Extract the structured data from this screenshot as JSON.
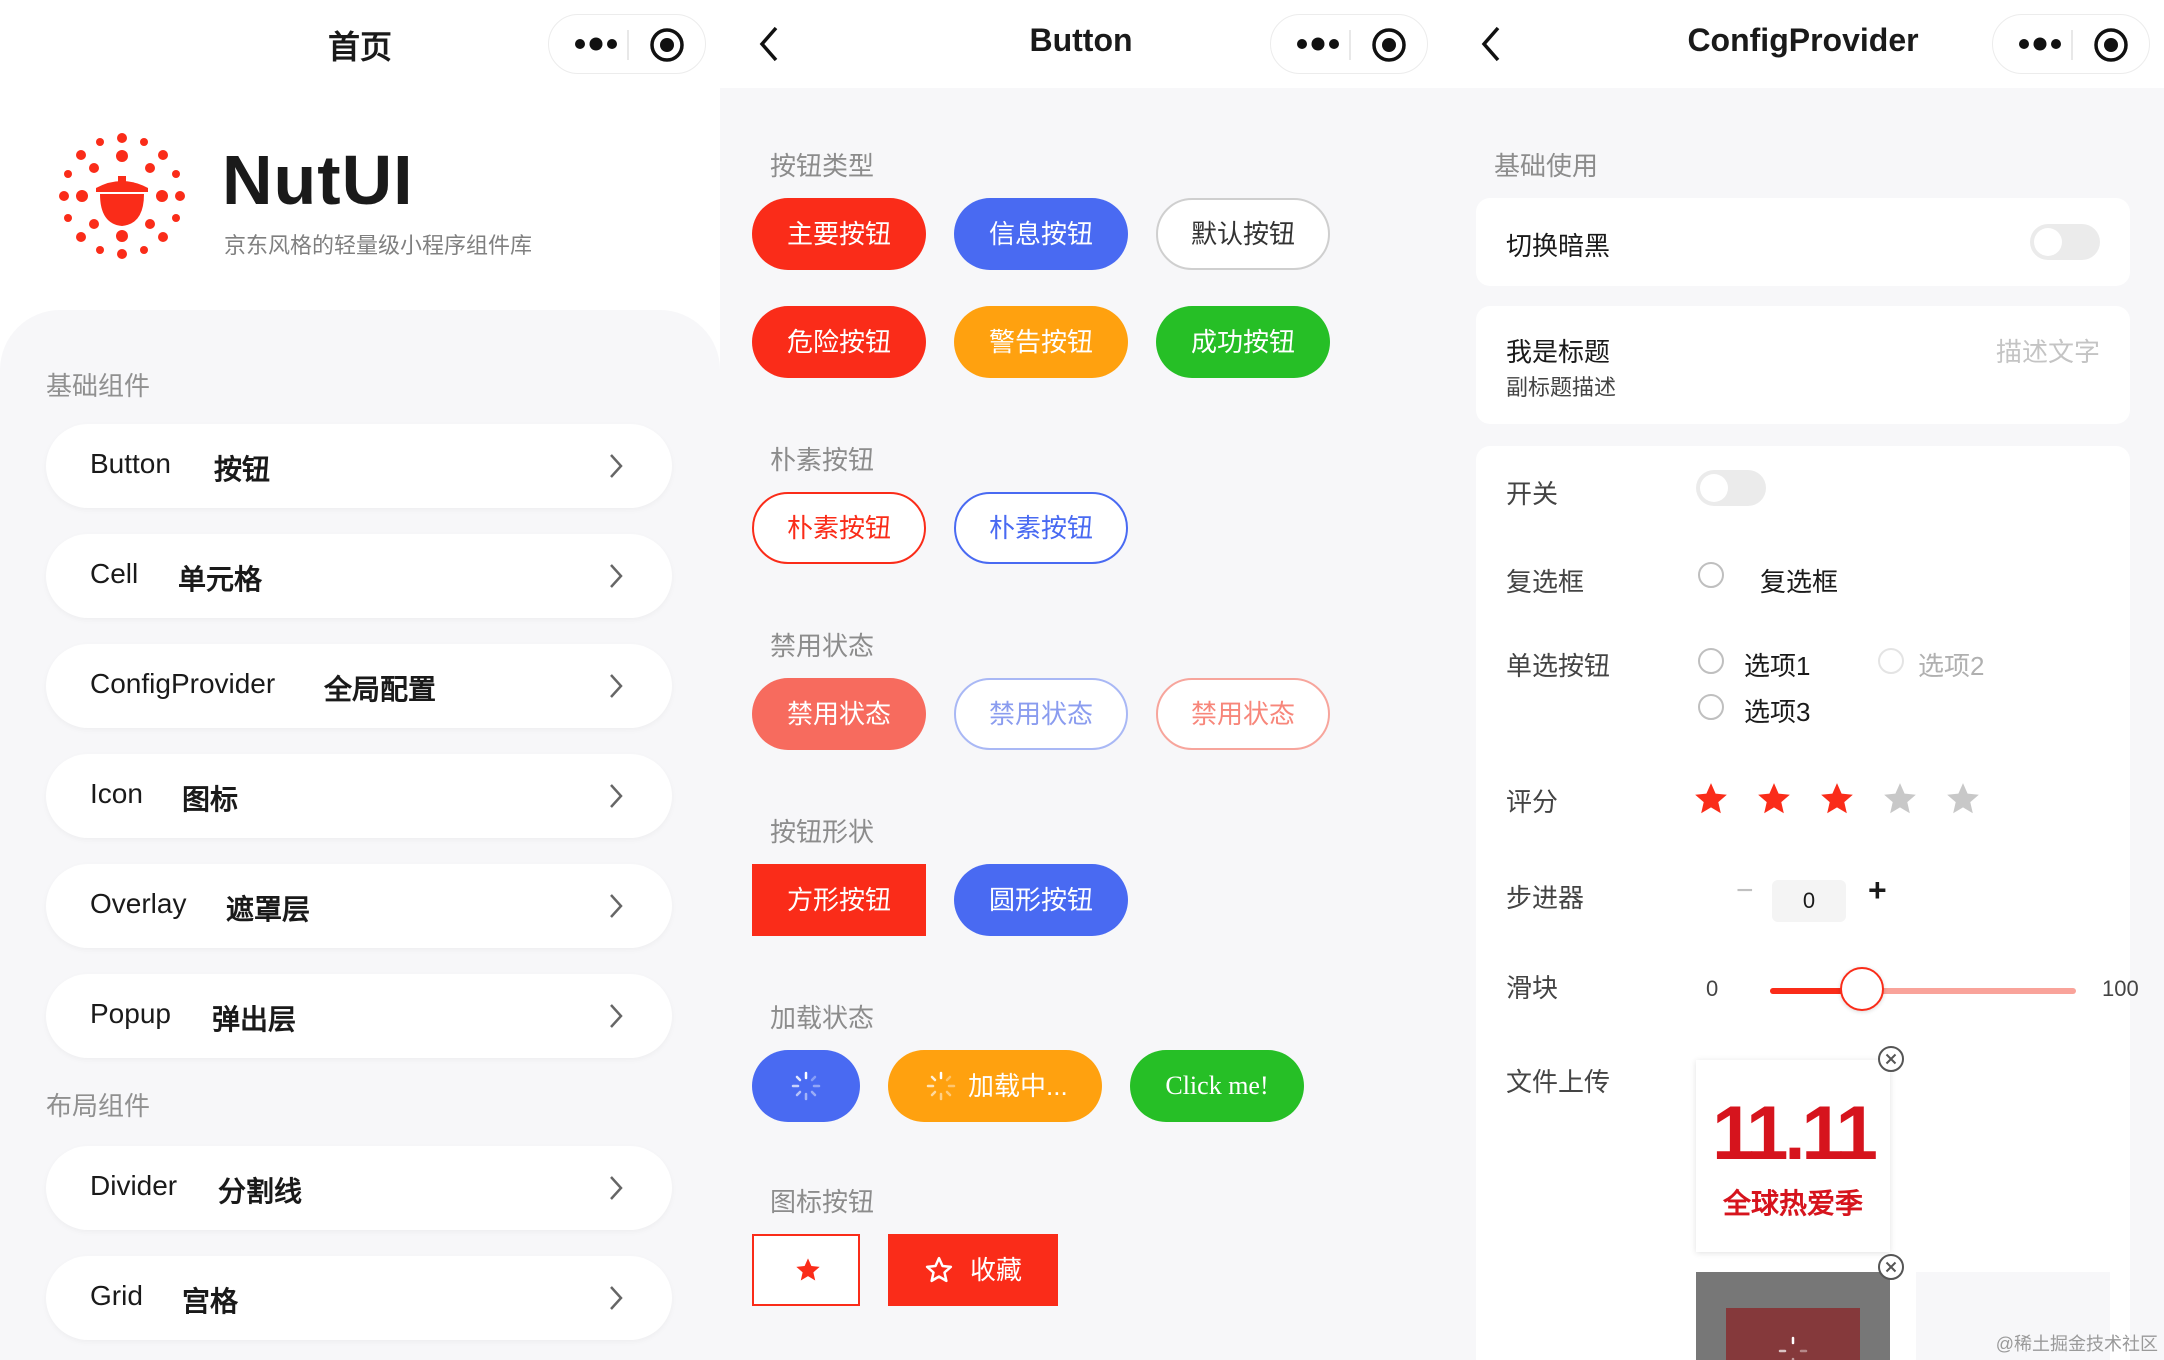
{
  "home": {
    "nav_title": "首页",
    "brand": {
      "name": "NutUI",
      "subtitle": "京东风格的轻量级小程序组件库"
    },
    "sections": [
      {
        "title": "基础组件",
        "items": [
          {
            "en": "Button",
            "zh": "按钮"
          },
          {
            "en": "Cell",
            "zh": "单元格"
          },
          {
            "en": "ConfigProvider",
            "zh": "全局配置"
          },
          {
            "en": "Icon",
            "zh": "图标"
          },
          {
            "en": "Overlay",
            "zh": "遮罩层"
          },
          {
            "en": "Popup",
            "zh": "弹出层"
          }
        ]
      },
      {
        "title": "布局组件",
        "items": [
          {
            "en": "Divider",
            "zh": "分割线"
          },
          {
            "en": "Grid",
            "zh": "宫格"
          }
        ]
      }
    ]
  },
  "button_page": {
    "nav_title": "Button",
    "groups": {
      "types": {
        "title": "按钮类型",
        "buttons": [
          "主要按钮",
          "信息按钮",
          "默认按钮",
          "危险按钮",
          "警告按钮",
          "成功按钮"
        ]
      },
      "plain": {
        "title": "朴素按钮",
        "buttons": [
          "朴素按钮",
          "朴素按钮"
        ]
      },
      "disabled": {
        "title": "禁用状态",
        "buttons": [
          "禁用状态",
          "禁用状态",
          "禁用状态"
        ]
      },
      "shape": {
        "title": "按钮形状",
        "buttons": [
          "方形按钮",
          "圆形按钮"
        ]
      },
      "loading": {
        "title": "加载状态",
        "buttons": [
          "",
          "加载中...",
          "Click me!"
        ]
      },
      "icon": {
        "title": "图标按钮",
        "buttons": [
          "",
          "收藏"
        ]
      }
    }
  },
  "config_page": {
    "nav_title": "ConfigProvider",
    "section_title": "基础使用",
    "dark_toggle_label": "切换暗黑",
    "cell": {
      "title": "我是标题",
      "subtitle": "副标题描述",
      "desc": "描述文字"
    },
    "form": {
      "switch_label": "开关",
      "checkbox_label": "复选框",
      "checkbox_text": "复选框",
      "radio_label": "单选按钮",
      "radio_options": [
        "选项1",
        "选项2",
        "选项3"
      ],
      "rate_label": "评分",
      "rate_value": 3,
      "rate_max": 5,
      "stepper_label": "步进器",
      "stepper_value": "0",
      "stepper_minus": "−",
      "stepper_plus": "+",
      "slider_label": "滑块",
      "slider_min": "0",
      "slider_max": "100",
      "slider_value": 30,
      "upload_label": "文件上传",
      "upload_image_text": "全球热爱季",
      "upload_image_logo": "11.11"
    }
  },
  "watermark": "@稀土掘金技术社区",
  "colors": {
    "primary": "#fa2c19",
    "info": "#496af2",
    "warning": "#ff9e0d",
    "success": "#26bf26",
    "disabled_red": "#f76b5e"
  }
}
